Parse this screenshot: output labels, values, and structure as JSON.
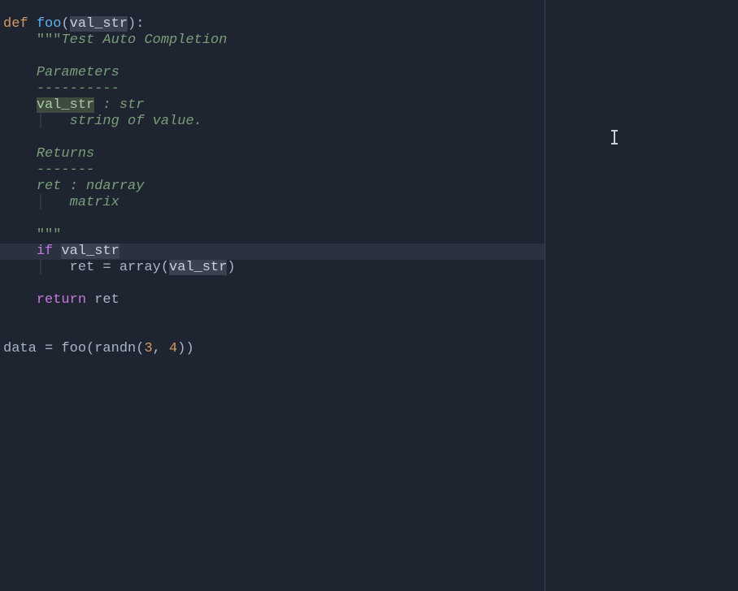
{
  "code": {
    "line1": {
      "def": "def ",
      "fn": "foo",
      "open": "(",
      "param": "val_str",
      "close": "):"
    },
    "line2": {
      "indent": "    ",
      "delim": "\"\"\"",
      "text": "Test Auto Completion"
    },
    "line3": "",
    "line4": {
      "indent": "    ",
      "text": "Parameters"
    },
    "line5": {
      "indent": "    ",
      "text": "----------"
    },
    "line6": {
      "indent": "    ",
      "param": "val_str",
      "text": " : str"
    },
    "line7": {
      "indent": "    ",
      "guide": "│",
      "indent2": "   ",
      "text": "string of value."
    },
    "line8": "",
    "line9": {
      "indent": "    ",
      "text": "Returns"
    },
    "line10": {
      "indent": "    ",
      "text": "-------"
    },
    "line11": {
      "indent": "    ",
      "text": "ret : ndarray"
    },
    "line12": {
      "indent": "    ",
      "guide": "│",
      "indent2": "   ",
      "text": "matrix"
    },
    "line13": "",
    "line14": {
      "indent": "    ",
      "delim": "\"\"\""
    },
    "line15": {
      "indent": "    ",
      "kw": "if ",
      "var": "val_str"
    },
    "line16": {
      "indent": "    ",
      "guide": "│",
      "indent2": "   ",
      "text1": "ret = array(",
      "var": "val_str",
      "text2": ")"
    },
    "line17": "",
    "line18": {
      "indent": "    ",
      "kw": "return",
      "text": " ret"
    },
    "line19": "",
    "line20": "",
    "line21": {
      "text1": "data = foo(randn(",
      "num1": "3",
      "comma": ", ",
      "num2": "4",
      "text2": "))"
    }
  },
  "colors": {
    "background": "#1e2430",
    "foreground": "#a8b5c4",
    "keyword_def": "#d19a66",
    "keyword_flow": "#c678dd",
    "function": "#61afef",
    "docstring": "#7a9e7a",
    "number": "#d19a66",
    "highlight_bg": "#3a4252",
    "param_highlight_bg": "#3e4a3e",
    "current_line_bg": "#2a3140"
  }
}
